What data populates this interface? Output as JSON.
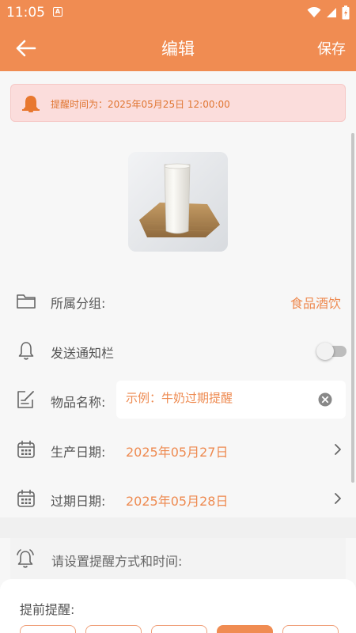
{
  "status_bar": {
    "time": "11:05",
    "badge": "A"
  },
  "app_bar": {
    "title": "编辑",
    "save_label": "保存"
  },
  "notice": {
    "text": "提醒时间为：2025年05月25日 12:00:00"
  },
  "item_image": {
    "description_icon": "milk-glass-image"
  },
  "rows": {
    "group": {
      "label": "所属分组:",
      "value": "食品酒饮"
    },
    "notify": {
      "label": "发送通知栏",
      "enabled": false
    },
    "name": {
      "label": "物品名称:",
      "placeholder": "示例：牛奶过期提醒",
      "value": ""
    },
    "production_date": {
      "label": "生产日期:",
      "value": "2025年05月27日"
    },
    "expiry_date": {
      "label": "过期日期:",
      "value": "2025年05月28日"
    }
  },
  "reminder": {
    "label": "请设置提醒方式和时间:"
  },
  "advance": {
    "label": "提前提醒:",
    "chips": [
      {
        "active": false
      },
      {
        "active": false
      },
      {
        "active": false
      },
      {
        "active": true
      },
      {
        "active": false
      }
    ]
  },
  "colors": {
    "accent": "#f08c52",
    "notice_bg": "#fbdddc",
    "value_text": "#ee8a50"
  }
}
